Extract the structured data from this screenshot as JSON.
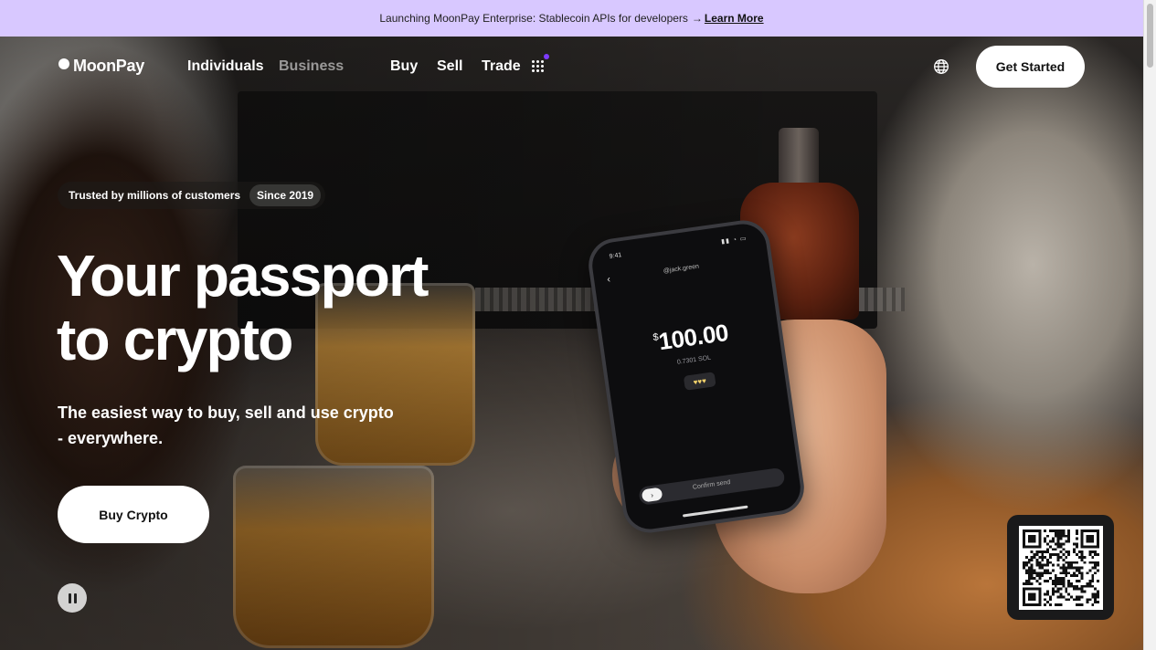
{
  "announcement": {
    "text": "Launching MoonPay Enterprise: Stablecoin APIs for developers",
    "arrow": "→",
    "link": "Learn More"
  },
  "nav": {
    "logo": "MoonPay",
    "segments": [
      "Individuals",
      "Business"
    ],
    "links": [
      "Buy",
      "Sell",
      "Trade"
    ],
    "cta": "Get Started"
  },
  "hero": {
    "trust_text": "Trusted by millions of customers",
    "since": "Since 2019",
    "headline_line1": "Your passport",
    "headline_line2": "to crypto",
    "subhead_line1": "The easiest way to buy, sell and use crypto",
    "subhead_line2": "- everywhere.",
    "cta": "Buy Crypto"
  },
  "phone": {
    "time": "9:41",
    "recipient": "@jack.green",
    "currency": "$",
    "amount": "100.00",
    "sol_amount": "0.7301 SOL",
    "slider_label": "Confirm send",
    "slider_knob": "›"
  },
  "colors": {
    "announce_bg": "#d8c8ff",
    "accent_badge": "#7d3bff"
  },
  "icons": [
    "moon-logo-icon",
    "apps-grid-icon",
    "globe-icon",
    "pause-icon",
    "qr-code"
  ]
}
